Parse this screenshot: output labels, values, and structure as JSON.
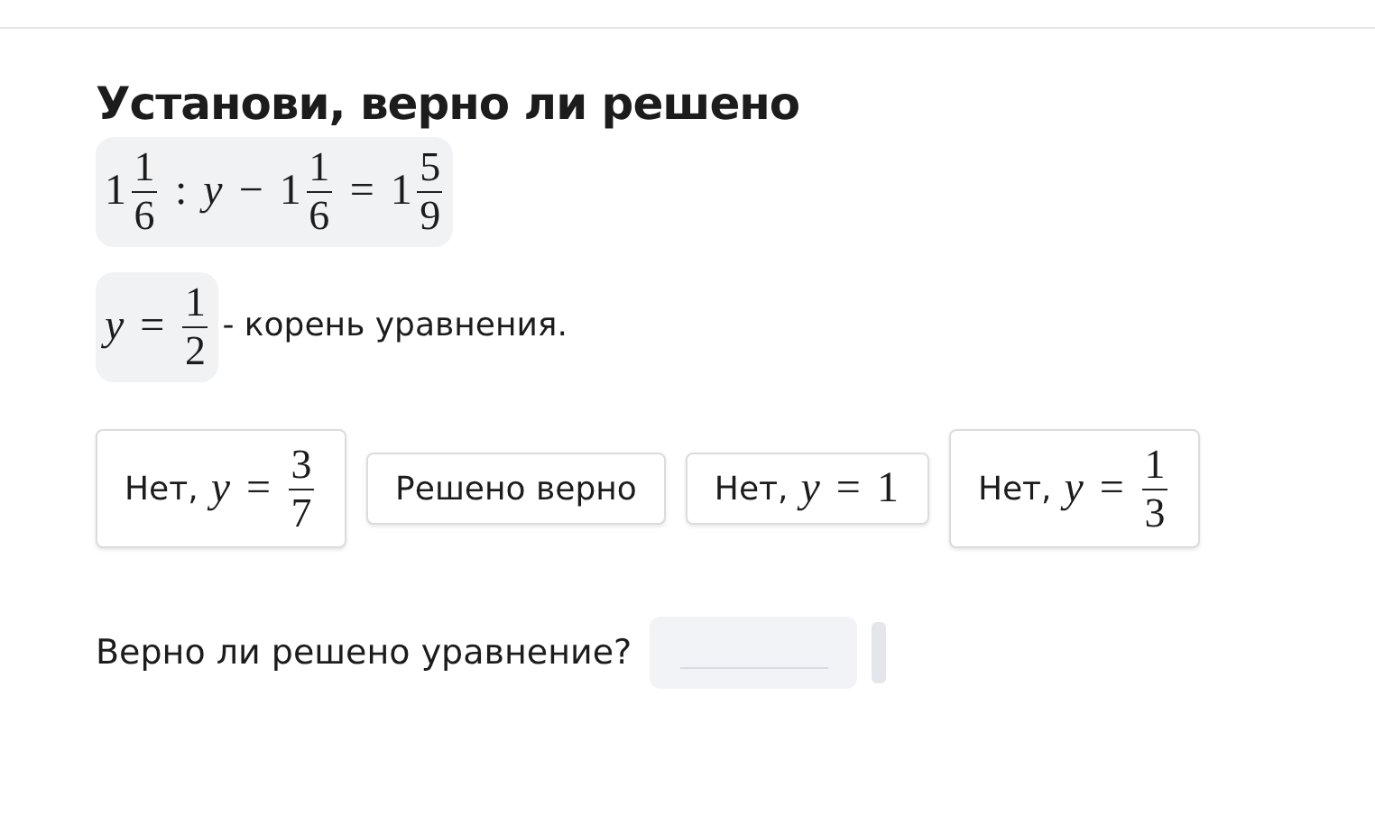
{
  "title": "Установи, верно ли решено",
  "equation": [
    {
      "kind": "mixed",
      "whole": "1",
      "num": "1",
      "den": "6"
    },
    {
      "kind": "op",
      "text": ":"
    },
    {
      "kind": "var",
      "text": "y"
    },
    {
      "kind": "op",
      "text": "−"
    },
    {
      "kind": "mixed",
      "whole": "1",
      "num": "1",
      "den": "6"
    },
    {
      "kind": "op",
      "text": "="
    },
    {
      "kind": "mixed",
      "whole": "1",
      "num": "5",
      "den": "9"
    }
  ],
  "root": {
    "math": [
      {
        "kind": "var",
        "text": "y"
      },
      {
        "kind": "op",
        "text": "="
      },
      {
        "kind": "frac",
        "num": "1",
        "den": "2"
      }
    ],
    "text": "- корень уравнения."
  },
  "options": [
    {
      "kind": "math",
      "prefix": "Нет,",
      "math": [
        {
          "kind": "var",
          "text": "y"
        },
        {
          "kind": "op",
          "text": "="
        },
        {
          "kind": "frac",
          "num": "3",
          "den": "7"
        }
      ]
    },
    {
      "kind": "text",
      "label": "Решено верно"
    },
    {
      "kind": "math",
      "prefix": "Нет,",
      "math": [
        {
          "kind": "var",
          "text": "y"
        },
        {
          "kind": "op",
          "text": "="
        },
        {
          "kind": "num",
          "text": "1"
        }
      ]
    },
    {
      "kind": "math",
      "prefix": "Нет,",
      "math": [
        {
          "kind": "var",
          "text": "y"
        },
        {
          "kind": "op",
          "text": "="
        },
        {
          "kind": "frac",
          "num": "1",
          "den": "3"
        }
      ]
    }
  ],
  "question": {
    "label": "Верно ли решено уравнение?"
  }
}
